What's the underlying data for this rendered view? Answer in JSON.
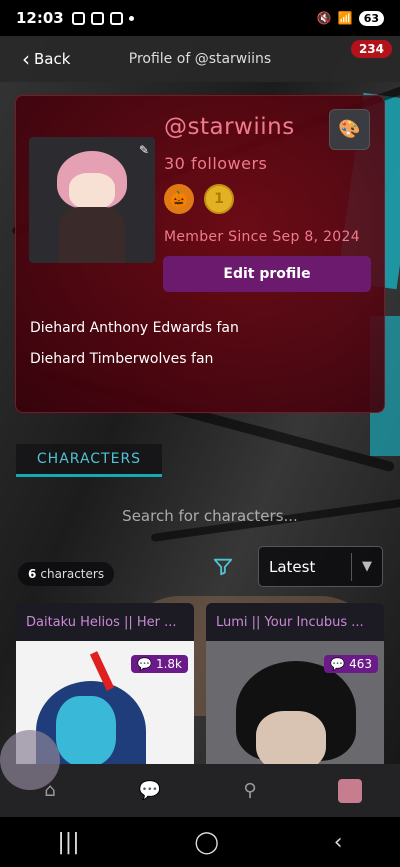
{
  "status_bar": {
    "time": "12:03",
    "battery": "63"
  },
  "header": {
    "back_label": "Back",
    "title": "Profile of @starwiins",
    "notification_count": "234"
  },
  "profile": {
    "username": "@starwiins",
    "followers": "30 followers",
    "member_since": "Member Since Sep 8, 2024",
    "edit_label": "Edit profile",
    "badges": [
      "pumpkin-badge",
      "coin-badge"
    ],
    "bio": [
      "Diehard Anthony Edwards fan",
      "Diehard Timberwolves fan"
    ]
  },
  "tabs": {
    "characters": "CHARACTERS"
  },
  "search": {
    "placeholder": "Search for characters..."
  },
  "list": {
    "count": "6",
    "count_label": "characters",
    "sort_value": "Latest"
  },
  "characters": [
    {
      "name": "Daitaku Helios || Her ...",
      "stat": "1.8k"
    },
    {
      "name": "Lumi || Your Incubus ...",
      "stat": "463"
    }
  ],
  "colors": {
    "accent_pink": "#f07b8c",
    "accent_teal": "#1aa7b5",
    "button_purple": "#6b1a6e",
    "notification_red": "#b3121a"
  }
}
